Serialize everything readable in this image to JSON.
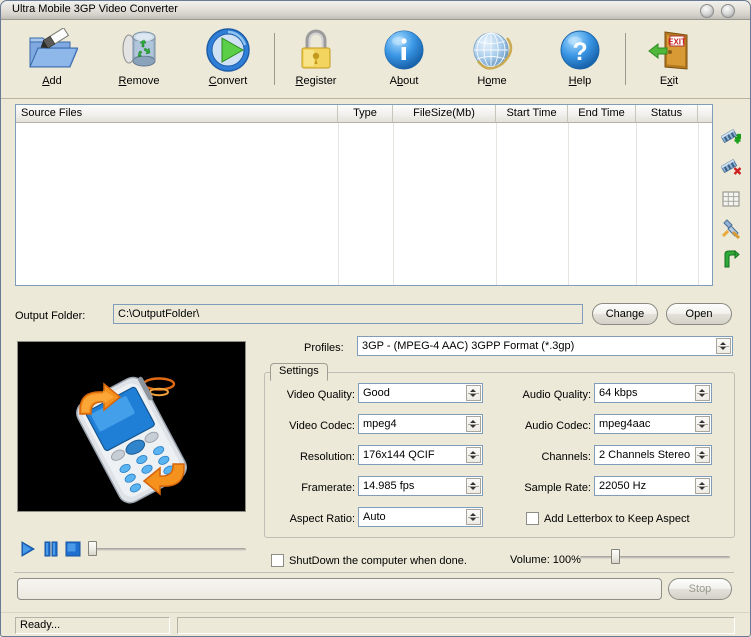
{
  "window": {
    "title": "Ultra Mobile 3GP Video Converter",
    "minimize_icon": "minimize-circle-icon",
    "close_icon": "close-circle-icon"
  },
  "toolbar": {
    "items": [
      {
        "id": "add",
        "label": "Add",
        "accel": "A",
        "icon": "open-folder-pencil-icon"
      },
      {
        "id": "remove",
        "label": "Remove",
        "accel": "R",
        "icon": "recycle-bin-icon"
      },
      {
        "id": "convert",
        "label": "Convert",
        "accel": "C",
        "icon": "green-play-circle-icon"
      },
      {
        "id": "register",
        "label": "Register",
        "accel": "R",
        "icon": "yellow-padlock-icon"
      },
      {
        "id": "about",
        "label": "About",
        "accel": "b",
        "icon": "blue-info-icon"
      },
      {
        "id": "home",
        "label": "Home",
        "accel": "o",
        "icon": "globe-icon"
      },
      {
        "id": "help",
        "label": "Help",
        "accel": "H",
        "icon": "blue-question-icon"
      },
      {
        "id": "exit",
        "label": "Exit",
        "accel": "x",
        "icon": "exit-door-icon"
      }
    ]
  },
  "filelist": {
    "columns": [
      {
        "key": "source",
        "label": "Source Files"
      },
      {
        "key": "type",
        "label": "Type"
      },
      {
        "key": "filesize",
        "label": "FileSize(Mb)"
      },
      {
        "key": "start",
        "label": "Start Time"
      },
      {
        "key": "end",
        "label": "End Time"
      },
      {
        "key": "status",
        "label": "Status"
      },
      {
        "key": "extra",
        "label": ""
      }
    ],
    "rows": []
  },
  "icon_strip": [
    {
      "id": "add-clip",
      "icon": "add-clip-icon"
    },
    {
      "id": "remove-clip",
      "icon": "remove-clip-icon"
    },
    {
      "id": "grid-view",
      "icon": "grid-icon"
    },
    {
      "id": "settings",
      "icon": "wrench-icon"
    },
    {
      "id": "go",
      "icon": "green-arrow-icon"
    }
  ],
  "output": {
    "label": "Output Folder:",
    "path": "C:\\OutputFolder\\",
    "change_label": "Change",
    "open_label": "Open"
  },
  "profiles": {
    "label": "Profiles:",
    "value": "3GP - (MPEG-4 AAC) 3GPP Format (*.3gp)"
  },
  "settings": {
    "tab_label": "Settings",
    "left": [
      {
        "label": "Video Quality:",
        "value": "Good"
      },
      {
        "label": "Video Codec:",
        "value": "mpeg4"
      },
      {
        "label": "Resolution:",
        "value": "176x144 QCIF"
      },
      {
        "label": "Framerate:",
        "value": "14.985 fps"
      },
      {
        "label": "Aspect Ratio:",
        "value": "Auto"
      }
    ],
    "right": [
      {
        "label": "Audio Quality:",
        "value": "64  kbps"
      },
      {
        "label": "Audio Codec:",
        "value": "mpeg4aac"
      },
      {
        "label": "Channels:",
        "value": "2 Channels Stereo"
      },
      {
        "label": "Sample Rate:",
        "value": "22050 Hz"
      }
    ],
    "letterbox": {
      "label": "Add Letterbox to Keep Aspect",
      "checked": false
    }
  },
  "preview": {
    "art": "mobile-phone-rotation-icon",
    "play_label": "Play",
    "pause_label": "Pause",
    "stop_label": "Stop",
    "position_percent": 0
  },
  "bottom": {
    "shutdown": {
      "label": "ShutDown the computer when done.",
      "checked": false
    },
    "volume_label": "Volume: 100%",
    "volume_percent": 25,
    "progress_percent": 0,
    "stop_label": "Stop",
    "stop_enabled": false
  },
  "statusbar": {
    "pane1": "Ready...",
    "pane2": ""
  },
  "colors": {
    "face": "#ece9d8",
    "accent_blue": "#1f6fd0",
    "field_border": "#7f9db9",
    "preview_bg": "#000000"
  }
}
